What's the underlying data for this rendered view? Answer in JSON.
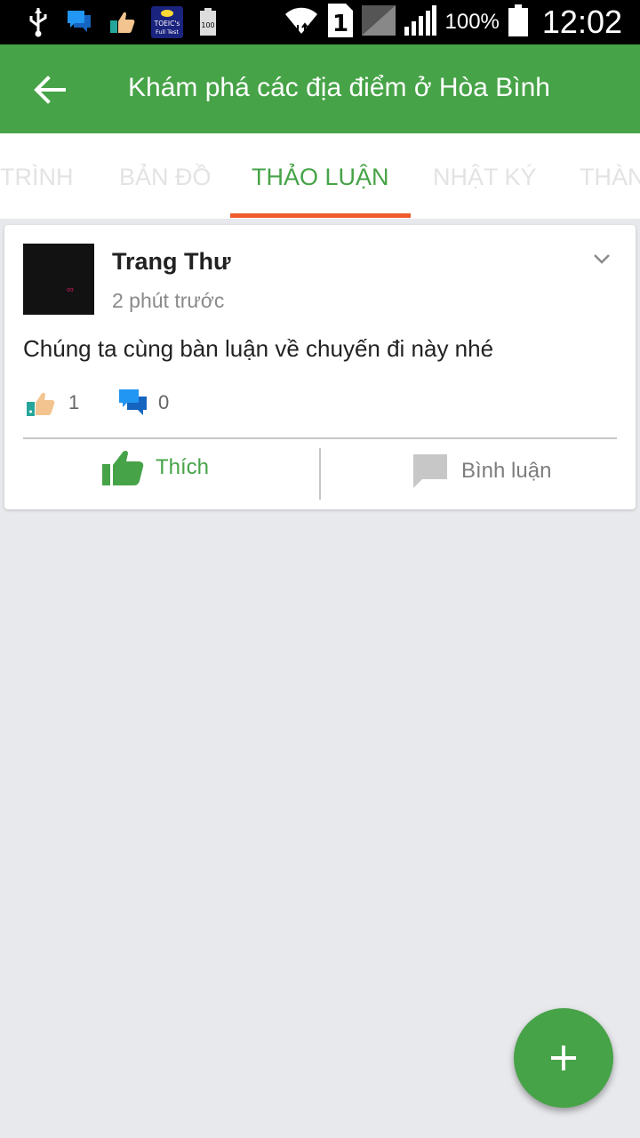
{
  "status_bar": {
    "battery_percent": "100%",
    "time": "12:02",
    "sim_label": "1",
    "toeic_line1": "TOEIC's",
    "toeic_line2": "Full Test",
    "badge_100": "100",
    "icons": [
      "usb-icon",
      "chat-notification-icon",
      "like-notification-icon",
      "toeic-app-icon",
      "battery-saver-icon",
      "wifi-icon",
      "sim-icon",
      "signal-icon",
      "battery-icon"
    ]
  },
  "app_bar": {
    "title": "Khám phá các địa điểm ở Hòa Bình",
    "back_icon": "arrow-back-icon",
    "color": "#46a347"
  },
  "tabs": [
    {
      "label": "TRÌNH"
    },
    {
      "label": "BẢN ĐỒ"
    },
    {
      "label": "THẢO LUẬN",
      "active": true
    },
    {
      "label": "NHẬT KÝ"
    },
    {
      "label": "THÀN"
    }
  ],
  "tab_indicator_color": "#ef5a2d",
  "post": {
    "author": "Trang Thư",
    "time": "2 phút trước",
    "text": "Chúng ta cùng bàn luận về chuyến đi này nhé",
    "like_count": "1",
    "comment_count": "0",
    "like_label": "Thích",
    "comment_label": "Bình luận"
  },
  "fab": {
    "icon": "plus-icon"
  }
}
